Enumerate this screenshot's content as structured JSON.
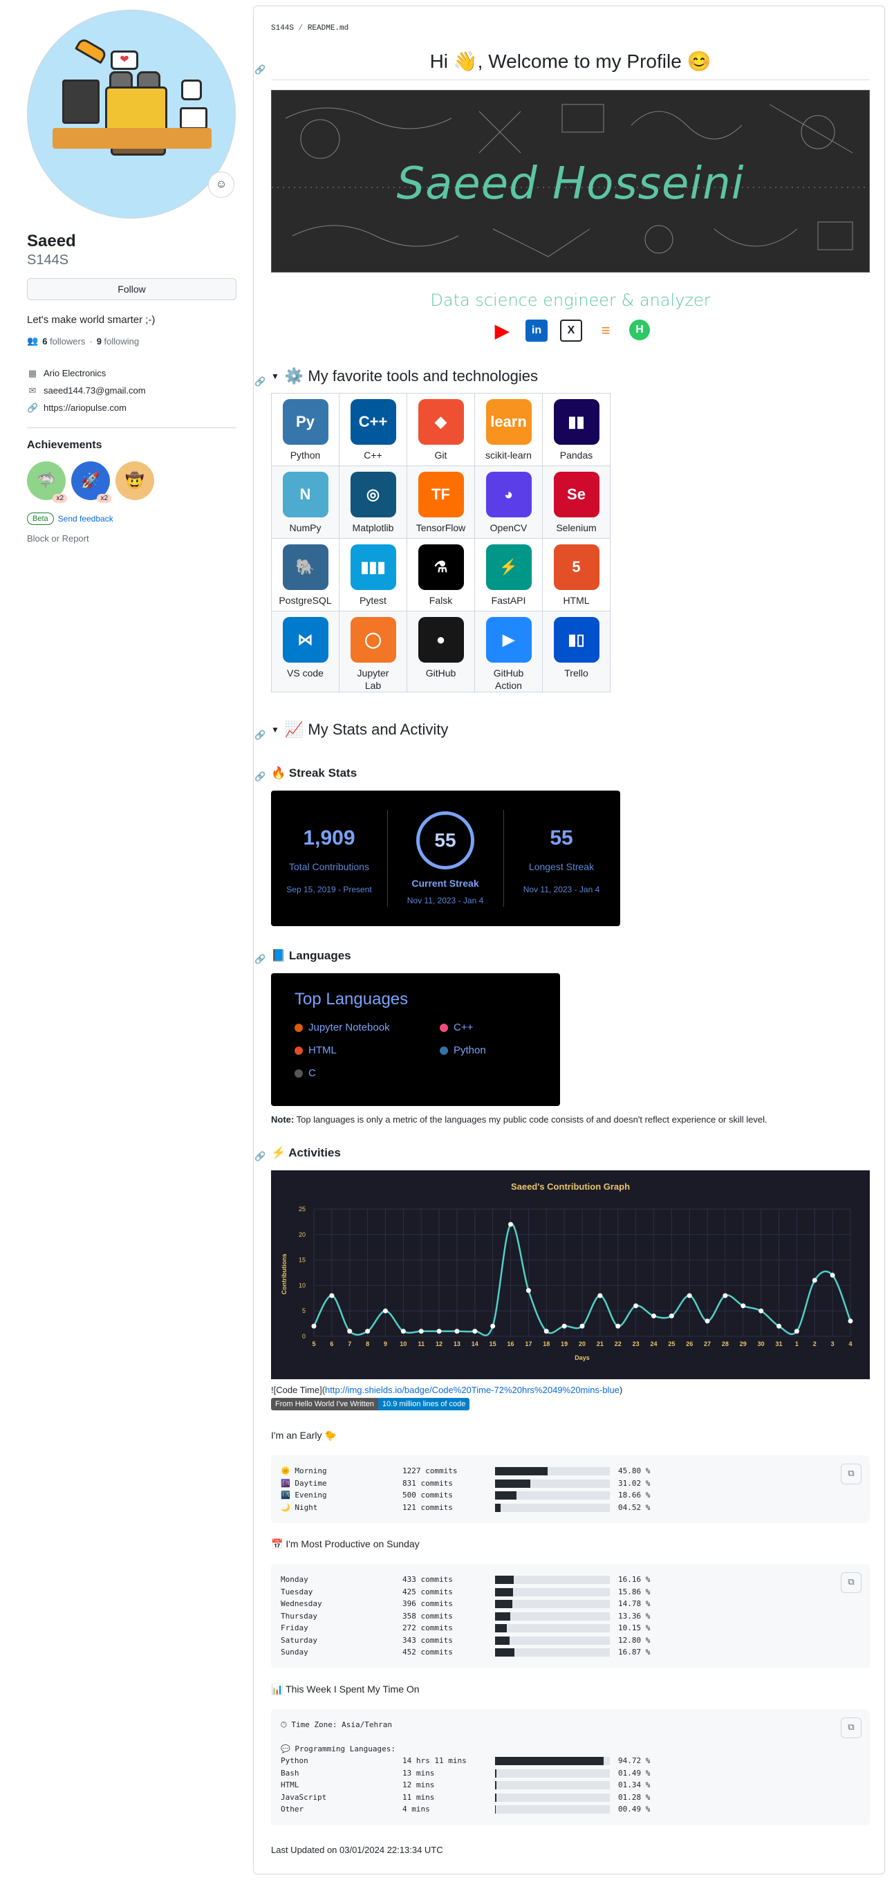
{
  "sidebar": {
    "name": "Saeed",
    "login": "S144S",
    "follow_label": "Follow",
    "bio": "Let's make world smarter ;-)",
    "followers_count": "6",
    "followers_label": "followers",
    "following_count": "9",
    "following_label": "following",
    "company": "Ario Electronics",
    "email": "saeed144.73@gmail.com",
    "website": "https://ariopulse.com",
    "achievements_title": "Achievements",
    "badges": [
      {
        "multiplier": "x2"
      },
      {
        "multiplier": "x2"
      },
      {
        "multiplier": ""
      }
    ],
    "beta_label": "Beta",
    "feedback_label": "Send feedback",
    "block_label": "Block or Report"
  },
  "readme": {
    "path_user": "S144S",
    "path_sep": " / ",
    "path_file": "README.md",
    "welcome": "Hi 👋, Welcome to my Profile 😊",
    "banner_name": "Saeed Hosseini",
    "tagline": "Data science engineer & analyzer",
    "tools_heading": "⚙️ My favorite tools and technologies",
    "tools": [
      [
        {
          "name": "Python",
          "color": "#3776ab",
          "glyph": "Py"
        },
        {
          "name": "C++",
          "color": "#00599c",
          "glyph": "C++"
        },
        {
          "name": "Git",
          "color": "#f05032",
          "glyph": "◆"
        },
        {
          "name": "scikit-learn",
          "color": "#f7931e",
          "glyph": "learn"
        },
        {
          "name": "Pandas",
          "color": "#150458",
          "glyph": "▮▮"
        }
      ],
      [
        {
          "name": "NumPy",
          "color": "#4dabcf",
          "glyph": "N"
        },
        {
          "name": "Matplotlib",
          "color": "#11557c",
          "glyph": "◎"
        },
        {
          "name": "TensorFlow",
          "color": "#ff6f00",
          "glyph": "TF"
        },
        {
          "name": "OpenCV",
          "color": "#5c3ee8",
          "glyph": "◕"
        },
        {
          "name": "Selenium",
          "color": "#cf0a2c",
          "glyph": "Se"
        }
      ],
      [
        {
          "name": "PostgreSQL",
          "color": "#336791",
          "glyph": "🐘"
        },
        {
          "name": "Pytest",
          "color": "#0a9edc",
          "glyph": "▮▮▮"
        },
        {
          "name": "Falsk",
          "color": "#000000",
          "glyph": "⚗"
        },
        {
          "name": "FastAPI",
          "color": "#009688",
          "glyph": "⚡"
        },
        {
          "name": "HTML",
          "color": "#e34f26",
          "glyph": "5"
        }
      ],
      [
        {
          "name": "VS code",
          "color": "#007acc",
          "glyph": "⋈"
        },
        {
          "name": "Jupyter\nLab",
          "color": "#f37626",
          "glyph": "◯"
        },
        {
          "name": "GitHub",
          "color": "#181717",
          "glyph": "●"
        },
        {
          "name": "GitHub\nAction",
          "color": "#2088ff",
          "glyph": "▶"
        },
        {
          "name": "Trello",
          "color": "#0052cc",
          "glyph": "▮▯"
        }
      ]
    ],
    "stats_heading": "📈 My Stats and Activity",
    "streak_heading": "🔥 Streak Stats",
    "streak": {
      "total": "1,909",
      "total_label": "Total Contributions",
      "total_range": "Sep 15, 2019 - Present",
      "current": "55",
      "current_label": "Current Streak",
      "current_range": "Nov 11, 2023 - Jan 4",
      "longest": "55",
      "longest_label": "Longest Streak",
      "longest_range": "Nov 11, 2023 - Jan 4"
    },
    "languages_heading": "📘 Languages",
    "top_languages_title": "Top Languages",
    "languages": [
      {
        "name": "Jupyter Notebook",
        "color": "#da5b0b"
      },
      {
        "name": "C++",
        "color": "#f34b7d"
      },
      {
        "name": "HTML",
        "color": "#e34c26"
      },
      {
        "name": "Python",
        "color": "#3572a5"
      },
      {
        "name": "C",
        "color": "#555555"
      }
    ],
    "note_label": "Note:",
    "note_text": " Top languages is only a metric of the languages my public code consists of and doesn't reflect experience or skill level.",
    "activities_heading": "⚡ Activities",
    "codetime_prefix": "![Code Time](",
    "codetime_url": "http://img.shields.io/badge/Code%20Time-72%20hrs%2049%20mins-blue",
    "codetime_suffix": ")",
    "shield_left": "From Hello World I've Written",
    "shield_right": "10.9 million lines of code",
    "early_heading": "I'm an Early 🐤",
    "early_rows": [
      {
        "label": "🌞 Morning",
        "commits": "1227 commits",
        "pct": "45.80 %",
        "frac": 0.458
      },
      {
        "label": "🌆 Daytime",
        "commits": "831 commits",
        "pct": "31.02 %",
        "frac": 0.3102
      },
      {
        "label": "🌃 Evening",
        "commits": "500 commits",
        "pct": "18.66 %",
        "frac": 0.1866
      },
      {
        "label": "🌙 Night",
        "commits": "121 commits",
        "pct": "04.52 %",
        "frac": 0.0452
      }
    ],
    "productive_heading": "📅 I'm Most Productive on Sunday",
    "weekday_rows": [
      {
        "label": "Monday",
        "commits": "433 commits",
        "pct": "16.16 %",
        "frac": 0.1616
      },
      {
        "label": "Tuesday",
        "commits": "425 commits",
        "pct": "15.86 %",
        "frac": 0.1586
      },
      {
        "label": "Wednesday",
        "commits": "396 commits",
        "pct": "14.78 %",
        "frac": 0.1478
      },
      {
        "label": "Thursday",
        "commits": "358 commits",
        "pct": "13.36 %",
        "frac": 0.1336
      },
      {
        "label": "Friday",
        "commits": "272 commits",
        "pct": "10.15 %",
        "frac": 0.1015
      },
      {
        "label": "Saturday",
        "commits": "343 commits",
        "pct": "12.80 %",
        "frac": 0.128
      },
      {
        "label": "Sunday",
        "commits": "452 commits",
        "pct": "16.87 %",
        "frac": 0.1687
      }
    ],
    "week_heading": "📊 This Week I Spent My Time On",
    "timezone_line": "🕑︎ Time Zone: Asia/Tehran",
    "prog_lang_line": "💬 Programming Languages:",
    "week_rows": [
      {
        "label": "Python",
        "commits": "14 hrs 11 mins",
        "pct": "94.72 %",
        "frac": 0.9472
      },
      {
        "label": "Bash",
        "commits": "13 mins",
        "pct": "01.49 %",
        "frac": 0.0149
      },
      {
        "label": "HTML",
        "commits": "12 mins",
        "pct": "01.34 %",
        "frac": 0.0134
      },
      {
        "label": "JavaScript",
        "commits": "11 mins",
        "pct": "01.28 %",
        "frac": 0.0128
      },
      {
        "label": "Other",
        "commits": "4 mins",
        "pct": "00.49 %",
        "frac": 0.0049
      }
    ],
    "last_updated": "Last Updated on 03/01/2024 22:13:34 UTC"
  },
  "chart_data": {
    "type": "line",
    "title": "Saeed's Contribution Graph",
    "xlabel": "Days",
    "ylabel": "Contributions",
    "ylim": [
      0,
      25
    ],
    "yticks": [
      0,
      5,
      10,
      15,
      20,
      25
    ],
    "grid": true,
    "categories": [
      "5",
      "6",
      "7",
      "8",
      "9",
      "10",
      "11",
      "12",
      "13",
      "14",
      "15",
      "16",
      "17",
      "18",
      "19",
      "20",
      "21",
      "22",
      "23",
      "24",
      "25",
      "26",
      "27",
      "28",
      "29",
      "30",
      "31",
      "1",
      "2",
      "3",
      "4"
    ],
    "values": [
      2,
      8,
      1,
      1,
      5,
      1,
      1,
      1,
      1,
      1,
      2,
      22,
      9,
      1,
      2,
      2,
      8,
      2,
      6,
      4,
      4,
      8,
      3,
      8,
      6,
      5,
      2,
      1,
      11,
      12,
      3
    ],
    "colors": {
      "line": "#4fd1c5",
      "point": "#ffffff",
      "title": "#e9c46a",
      "axis": "#e9c46a",
      "grid": "#2c2f45"
    }
  }
}
